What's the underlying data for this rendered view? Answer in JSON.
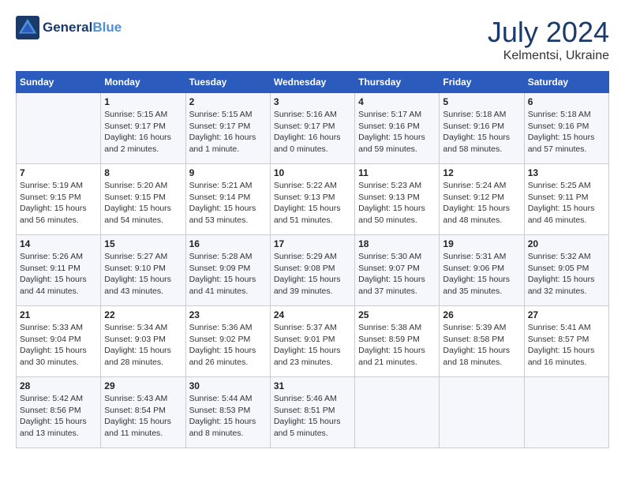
{
  "header": {
    "logo_general": "General",
    "logo_blue": "Blue",
    "month_year": "July 2024",
    "location": "Kelmentsi, Ukraine"
  },
  "weekdays": [
    "Sunday",
    "Monday",
    "Tuesday",
    "Wednesday",
    "Thursday",
    "Friday",
    "Saturday"
  ],
  "weeks": [
    [
      {
        "day": "",
        "info": ""
      },
      {
        "day": "1",
        "info": "Sunrise: 5:15 AM\nSunset: 9:17 PM\nDaylight: 16 hours\nand 2 minutes."
      },
      {
        "day": "2",
        "info": "Sunrise: 5:15 AM\nSunset: 9:17 PM\nDaylight: 16 hours\nand 1 minute."
      },
      {
        "day": "3",
        "info": "Sunrise: 5:16 AM\nSunset: 9:17 PM\nDaylight: 16 hours\nand 0 minutes."
      },
      {
        "day": "4",
        "info": "Sunrise: 5:17 AM\nSunset: 9:16 PM\nDaylight: 15 hours\nand 59 minutes."
      },
      {
        "day": "5",
        "info": "Sunrise: 5:18 AM\nSunset: 9:16 PM\nDaylight: 15 hours\nand 58 minutes."
      },
      {
        "day": "6",
        "info": "Sunrise: 5:18 AM\nSunset: 9:16 PM\nDaylight: 15 hours\nand 57 minutes."
      }
    ],
    [
      {
        "day": "7",
        "info": "Sunrise: 5:19 AM\nSunset: 9:15 PM\nDaylight: 15 hours\nand 56 minutes."
      },
      {
        "day": "8",
        "info": "Sunrise: 5:20 AM\nSunset: 9:15 PM\nDaylight: 15 hours\nand 54 minutes."
      },
      {
        "day": "9",
        "info": "Sunrise: 5:21 AM\nSunset: 9:14 PM\nDaylight: 15 hours\nand 53 minutes."
      },
      {
        "day": "10",
        "info": "Sunrise: 5:22 AM\nSunset: 9:13 PM\nDaylight: 15 hours\nand 51 minutes."
      },
      {
        "day": "11",
        "info": "Sunrise: 5:23 AM\nSunset: 9:13 PM\nDaylight: 15 hours\nand 50 minutes."
      },
      {
        "day": "12",
        "info": "Sunrise: 5:24 AM\nSunset: 9:12 PM\nDaylight: 15 hours\nand 48 minutes."
      },
      {
        "day": "13",
        "info": "Sunrise: 5:25 AM\nSunset: 9:11 PM\nDaylight: 15 hours\nand 46 minutes."
      }
    ],
    [
      {
        "day": "14",
        "info": "Sunrise: 5:26 AM\nSunset: 9:11 PM\nDaylight: 15 hours\nand 44 minutes."
      },
      {
        "day": "15",
        "info": "Sunrise: 5:27 AM\nSunset: 9:10 PM\nDaylight: 15 hours\nand 43 minutes."
      },
      {
        "day": "16",
        "info": "Sunrise: 5:28 AM\nSunset: 9:09 PM\nDaylight: 15 hours\nand 41 minutes."
      },
      {
        "day": "17",
        "info": "Sunrise: 5:29 AM\nSunset: 9:08 PM\nDaylight: 15 hours\nand 39 minutes."
      },
      {
        "day": "18",
        "info": "Sunrise: 5:30 AM\nSunset: 9:07 PM\nDaylight: 15 hours\nand 37 minutes."
      },
      {
        "day": "19",
        "info": "Sunrise: 5:31 AM\nSunset: 9:06 PM\nDaylight: 15 hours\nand 35 minutes."
      },
      {
        "day": "20",
        "info": "Sunrise: 5:32 AM\nSunset: 9:05 PM\nDaylight: 15 hours\nand 32 minutes."
      }
    ],
    [
      {
        "day": "21",
        "info": "Sunrise: 5:33 AM\nSunset: 9:04 PM\nDaylight: 15 hours\nand 30 minutes."
      },
      {
        "day": "22",
        "info": "Sunrise: 5:34 AM\nSunset: 9:03 PM\nDaylight: 15 hours\nand 28 minutes."
      },
      {
        "day": "23",
        "info": "Sunrise: 5:36 AM\nSunset: 9:02 PM\nDaylight: 15 hours\nand 26 minutes."
      },
      {
        "day": "24",
        "info": "Sunrise: 5:37 AM\nSunset: 9:01 PM\nDaylight: 15 hours\nand 23 minutes."
      },
      {
        "day": "25",
        "info": "Sunrise: 5:38 AM\nSunset: 8:59 PM\nDaylight: 15 hours\nand 21 minutes."
      },
      {
        "day": "26",
        "info": "Sunrise: 5:39 AM\nSunset: 8:58 PM\nDaylight: 15 hours\nand 18 minutes."
      },
      {
        "day": "27",
        "info": "Sunrise: 5:41 AM\nSunset: 8:57 PM\nDaylight: 15 hours\nand 16 minutes."
      }
    ],
    [
      {
        "day": "28",
        "info": "Sunrise: 5:42 AM\nSunset: 8:56 PM\nDaylight: 15 hours\nand 13 minutes."
      },
      {
        "day": "29",
        "info": "Sunrise: 5:43 AM\nSunset: 8:54 PM\nDaylight: 15 hours\nand 11 minutes."
      },
      {
        "day": "30",
        "info": "Sunrise: 5:44 AM\nSunset: 8:53 PM\nDaylight: 15 hours\nand 8 minutes."
      },
      {
        "day": "31",
        "info": "Sunrise: 5:46 AM\nSunset: 8:51 PM\nDaylight: 15 hours\nand 5 minutes."
      },
      {
        "day": "",
        "info": ""
      },
      {
        "day": "",
        "info": ""
      },
      {
        "day": "",
        "info": ""
      }
    ]
  ]
}
